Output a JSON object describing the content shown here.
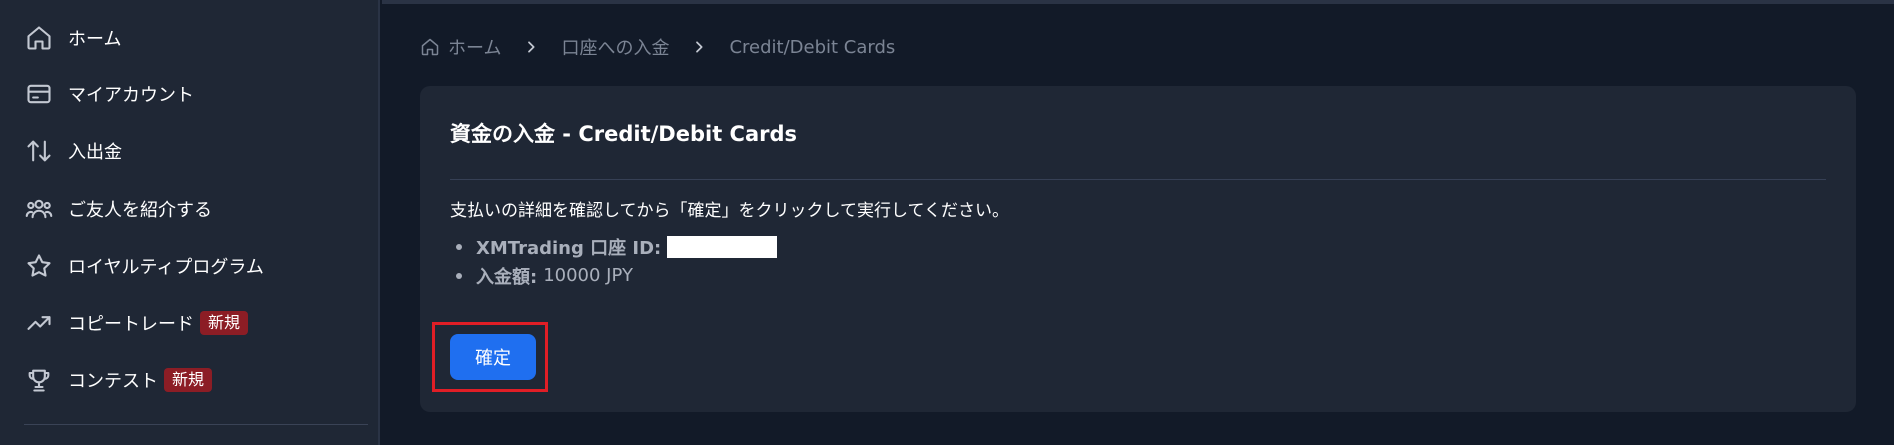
{
  "sidebar": {
    "items": [
      {
        "label": "ホーム",
        "icon": "home-icon"
      },
      {
        "label": "マイアカウント",
        "icon": "card-icon"
      },
      {
        "label": "入出金",
        "icon": "arrows-up-down-icon"
      },
      {
        "label": "ご友人を紹介する",
        "icon": "users-icon"
      },
      {
        "label": "ロイヤルティプログラム",
        "icon": "star-icon"
      },
      {
        "label": "コピートレード",
        "icon": "trend-up-icon",
        "badge": "新規"
      },
      {
        "label": "コンテスト",
        "icon": "trophy-icon",
        "badge": "新規"
      }
    ]
  },
  "breadcrumb": {
    "home": "ホーム",
    "deposit": "口座への入金",
    "current": "Credit/Debit Cards"
  },
  "card": {
    "title": "資金の入金 - Credit/Debit Cards",
    "instruction": "支払いの詳細を確認してから「確定」をクリックして実行してください。",
    "details": {
      "account_label": "XMTrading 口座 ID:",
      "amount_label": "入金額:",
      "amount_value": "10000 JPY"
    },
    "confirm_label": "確定"
  },
  "colors": {
    "accent": "#1f6ff0",
    "badge": "#8c1d25",
    "highlight": "#e01e26"
  }
}
